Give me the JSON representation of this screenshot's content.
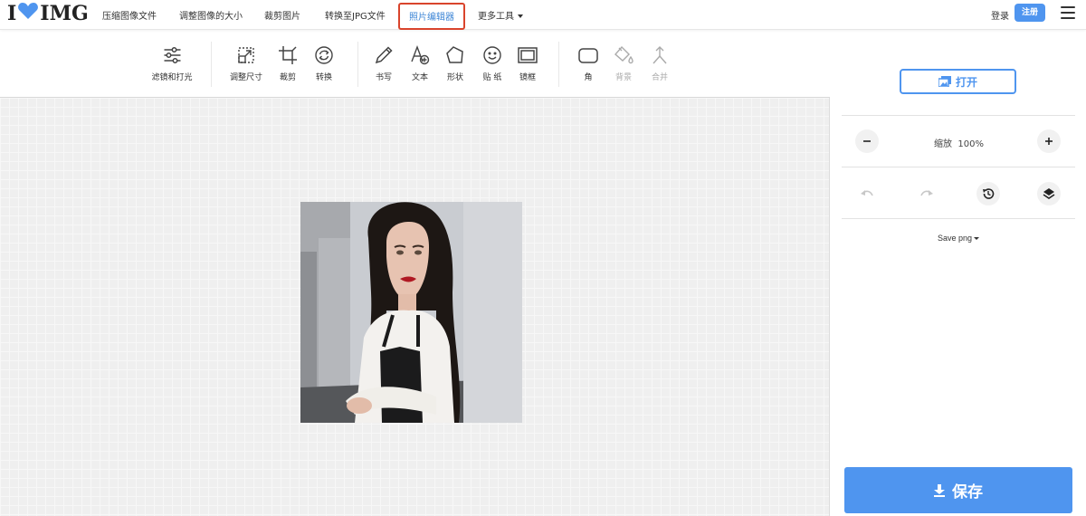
{
  "brand": {
    "logo_left": "I",
    "logo_right": "IMG",
    "heart_color": "#4f95ef"
  },
  "nav": {
    "items": [
      "压缩图像文件",
      "调整图像的大小",
      "裁剪图片",
      "转换至JPG文件",
      "照片编辑器",
      "更多工具"
    ],
    "active_index": 4,
    "login": "登录",
    "signup": "注册"
  },
  "toolbar": {
    "tools": [
      {
        "label": "滤镜和打光",
        "icon": "sliders-icon",
        "enabled": true
      },
      {
        "label": "调整尺寸",
        "icon": "resize-icon",
        "enabled": true
      },
      {
        "label": "裁剪",
        "icon": "crop-icon",
        "enabled": true
      },
      {
        "label": "转换",
        "icon": "rotate-icon",
        "enabled": true
      },
      {
        "label": "书写",
        "icon": "pencil-icon",
        "enabled": true
      },
      {
        "label": "文本",
        "icon": "text-add-icon",
        "enabled": true
      },
      {
        "label": "形状",
        "icon": "pentagon-icon",
        "enabled": true
      },
      {
        "label": "贴 纸",
        "icon": "smiley-icon",
        "enabled": true
      },
      {
        "label": "镜框",
        "icon": "frame-icon",
        "enabled": true
      },
      {
        "label": "角",
        "icon": "rounded-corner-icon",
        "enabled": true
      },
      {
        "label": "背景",
        "icon": "paint-bucket-icon",
        "enabled": false
      },
      {
        "label": "合并",
        "icon": "merge-icon",
        "enabled": false
      }
    ]
  },
  "panel": {
    "open_label": "打开",
    "zoom_label": "缩放",
    "zoom_value": "100%",
    "save_format": "Save png",
    "save_label": "保存"
  },
  "colors": {
    "accent": "#4f95ef",
    "active_outline": "#d9442c"
  }
}
